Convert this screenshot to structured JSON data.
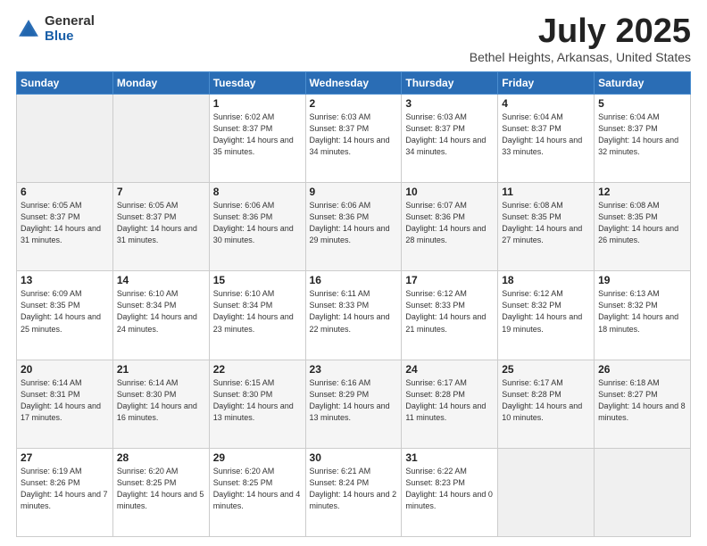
{
  "logo": {
    "general": "General",
    "blue": "Blue"
  },
  "title": {
    "month_year": "July 2025",
    "location": "Bethel Heights, Arkansas, United States"
  },
  "weekdays": [
    "Sunday",
    "Monday",
    "Tuesday",
    "Wednesday",
    "Thursday",
    "Friday",
    "Saturday"
  ],
  "weeks": [
    [
      {
        "day": "",
        "sunrise": "",
        "sunset": "",
        "daylight": ""
      },
      {
        "day": "",
        "sunrise": "",
        "sunset": "",
        "daylight": ""
      },
      {
        "day": "1",
        "sunrise": "Sunrise: 6:02 AM",
        "sunset": "Sunset: 8:37 PM",
        "daylight": "Daylight: 14 hours and 35 minutes."
      },
      {
        "day": "2",
        "sunrise": "Sunrise: 6:03 AM",
        "sunset": "Sunset: 8:37 PM",
        "daylight": "Daylight: 14 hours and 34 minutes."
      },
      {
        "day": "3",
        "sunrise": "Sunrise: 6:03 AM",
        "sunset": "Sunset: 8:37 PM",
        "daylight": "Daylight: 14 hours and 34 minutes."
      },
      {
        "day": "4",
        "sunrise": "Sunrise: 6:04 AM",
        "sunset": "Sunset: 8:37 PM",
        "daylight": "Daylight: 14 hours and 33 minutes."
      },
      {
        "day": "5",
        "sunrise": "Sunrise: 6:04 AM",
        "sunset": "Sunset: 8:37 PM",
        "daylight": "Daylight: 14 hours and 32 minutes."
      }
    ],
    [
      {
        "day": "6",
        "sunrise": "Sunrise: 6:05 AM",
        "sunset": "Sunset: 8:37 PM",
        "daylight": "Daylight: 14 hours and 31 minutes."
      },
      {
        "day": "7",
        "sunrise": "Sunrise: 6:05 AM",
        "sunset": "Sunset: 8:37 PM",
        "daylight": "Daylight: 14 hours and 31 minutes."
      },
      {
        "day": "8",
        "sunrise": "Sunrise: 6:06 AM",
        "sunset": "Sunset: 8:36 PM",
        "daylight": "Daylight: 14 hours and 30 minutes."
      },
      {
        "day": "9",
        "sunrise": "Sunrise: 6:06 AM",
        "sunset": "Sunset: 8:36 PM",
        "daylight": "Daylight: 14 hours and 29 minutes."
      },
      {
        "day": "10",
        "sunrise": "Sunrise: 6:07 AM",
        "sunset": "Sunset: 8:36 PM",
        "daylight": "Daylight: 14 hours and 28 minutes."
      },
      {
        "day": "11",
        "sunrise": "Sunrise: 6:08 AM",
        "sunset": "Sunset: 8:35 PM",
        "daylight": "Daylight: 14 hours and 27 minutes."
      },
      {
        "day": "12",
        "sunrise": "Sunrise: 6:08 AM",
        "sunset": "Sunset: 8:35 PM",
        "daylight": "Daylight: 14 hours and 26 minutes."
      }
    ],
    [
      {
        "day": "13",
        "sunrise": "Sunrise: 6:09 AM",
        "sunset": "Sunset: 8:35 PM",
        "daylight": "Daylight: 14 hours and 25 minutes."
      },
      {
        "day": "14",
        "sunrise": "Sunrise: 6:10 AM",
        "sunset": "Sunset: 8:34 PM",
        "daylight": "Daylight: 14 hours and 24 minutes."
      },
      {
        "day": "15",
        "sunrise": "Sunrise: 6:10 AM",
        "sunset": "Sunset: 8:34 PM",
        "daylight": "Daylight: 14 hours and 23 minutes."
      },
      {
        "day": "16",
        "sunrise": "Sunrise: 6:11 AM",
        "sunset": "Sunset: 8:33 PM",
        "daylight": "Daylight: 14 hours and 22 minutes."
      },
      {
        "day": "17",
        "sunrise": "Sunrise: 6:12 AM",
        "sunset": "Sunset: 8:33 PM",
        "daylight": "Daylight: 14 hours and 21 minutes."
      },
      {
        "day": "18",
        "sunrise": "Sunrise: 6:12 AM",
        "sunset": "Sunset: 8:32 PM",
        "daylight": "Daylight: 14 hours and 19 minutes."
      },
      {
        "day": "19",
        "sunrise": "Sunrise: 6:13 AM",
        "sunset": "Sunset: 8:32 PM",
        "daylight": "Daylight: 14 hours and 18 minutes."
      }
    ],
    [
      {
        "day": "20",
        "sunrise": "Sunrise: 6:14 AM",
        "sunset": "Sunset: 8:31 PM",
        "daylight": "Daylight: 14 hours and 17 minutes."
      },
      {
        "day": "21",
        "sunrise": "Sunrise: 6:14 AM",
        "sunset": "Sunset: 8:30 PM",
        "daylight": "Daylight: 14 hours and 16 minutes."
      },
      {
        "day": "22",
        "sunrise": "Sunrise: 6:15 AM",
        "sunset": "Sunset: 8:30 PM",
        "daylight": "Daylight: 14 hours and 13 minutes."
      },
      {
        "day": "23",
        "sunrise": "Sunrise: 6:16 AM",
        "sunset": "Sunset: 8:29 PM",
        "daylight": "Daylight: 14 hours and 13 minutes."
      },
      {
        "day": "24",
        "sunrise": "Sunrise: 6:17 AM",
        "sunset": "Sunset: 8:28 PM",
        "daylight": "Daylight: 14 hours and 11 minutes."
      },
      {
        "day": "25",
        "sunrise": "Sunrise: 6:17 AM",
        "sunset": "Sunset: 8:28 PM",
        "daylight": "Daylight: 14 hours and 10 minutes."
      },
      {
        "day": "26",
        "sunrise": "Sunrise: 6:18 AM",
        "sunset": "Sunset: 8:27 PM",
        "daylight": "Daylight: 14 hours and 8 minutes."
      }
    ],
    [
      {
        "day": "27",
        "sunrise": "Sunrise: 6:19 AM",
        "sunset": "Sunset: 8:26 PM",
        "daylight": "Daylight: 14 hours and 7 minutes."
      },
      {
        "day": "28",
        "sunrise": "Sunrise: 6:20 AM",
        "sunset": "Sunset: 8:25 PM",
        "daylight": "Daylight: 14 hours and 5 minutes."
      },
      {
        "day": "29",
        "sunrise": "Sunrise: 6:20 AM",
        "sunset": "Sunset: 8:25 PM",
        "daylight": "Daylight: 14 hours and 4 minutes."
      },
      {
        "day": "30",
        "sunrise": "Sunrise: 6:21 AM",
        "sunset": "Sunset: 8:24 PM",
        "daylight": "Daylight: 14 hours and 2 minutes."
      },
      {
        "day": "31",
        "sunrise": "Sunrise: 6:22 AM",
        "sunset": "Sunset: 8:23 PM",
        "daylight": "Daylight: 14 hours and 0 minutes."
      },
      {
        "day": "",
        "sunrise": "",
        "sunset": "",
        "daylight": ""
      },
      {
        "day": "",
        "sunrise": "",
        "sunset": "",
        "daylight": ""
      }
    ]
  ]
}
